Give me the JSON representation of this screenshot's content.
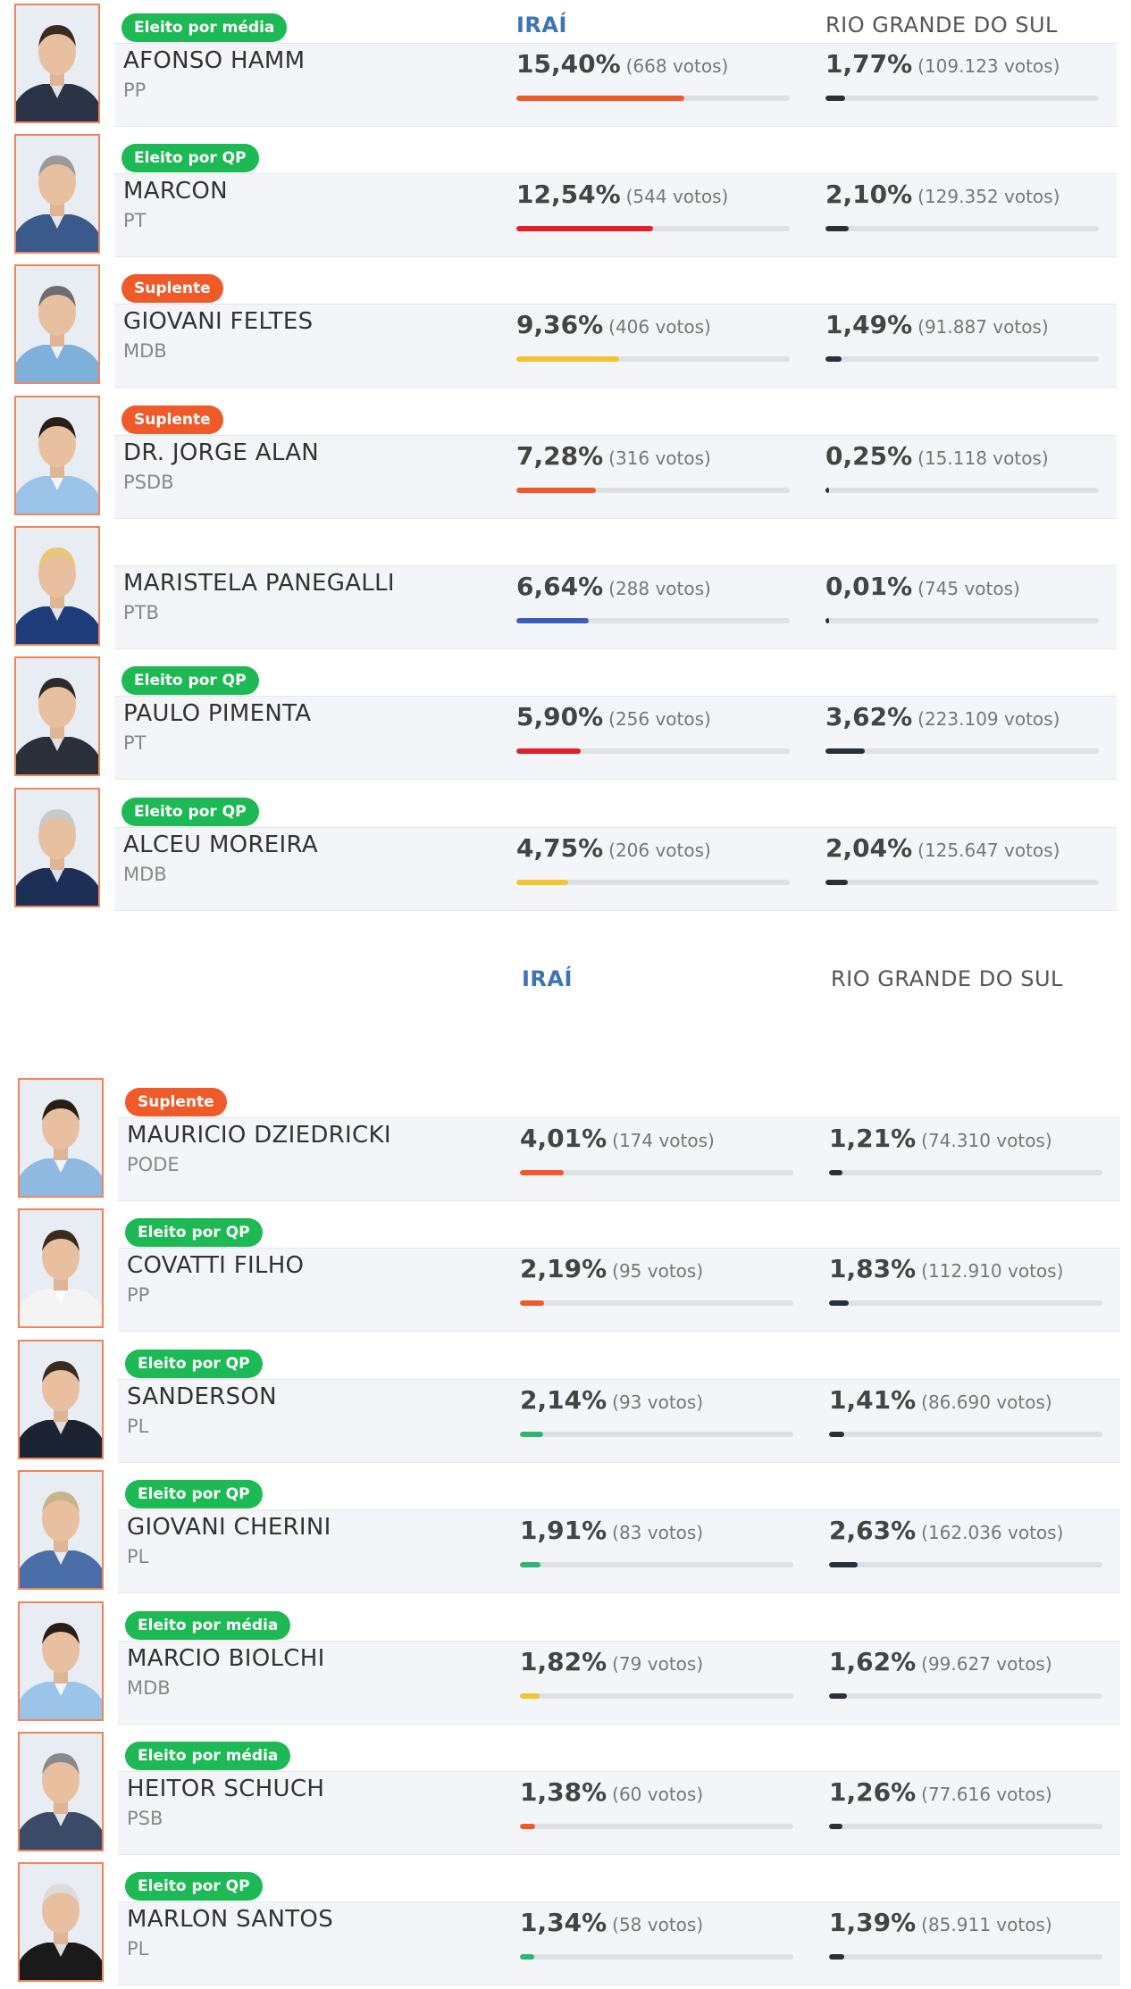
{
  "headers": {
    "irai": "IRAÍ",
    "rs": "RIO GRANDE DO SUL"
  },
  "candidates": [
    {
      "name": "AFONSO HAMM",
      "party": "PP",
      "badge": "Eleito por média",
      "badge_type": "green",
      "irai_pct": "15,40%",
      "irai_votes": "(668 votos)",
      "irai_share": 0.154,
      "rs_pct": "1,77%",
      "rs_votes": "(109.123 votos)",
      "rs_share": 0.0177,
      "color": "#f05a28"
    },
    {
      "name": "MARCON",
      "party": "PT",
      "badge": "Eleito por QP",
      "badge_type": "green",
      "irai_pct": "12,54%",
      "irai_votes": "(544 votos)",
      "irai_share": 0.1254,
      "rs_pct": "2,10%",
      "rs_votes": "(129.352 votos)",
      "rs_share": 0.021,
      "color": "#e0202a"
    },
    {
      "name": "GIOVANI FELTES",
      "party": "MDB",
      "badge": "Suplente",
      "badge_type": "orange",
      "irai_pct": "9,36%",
      "irai_votes": "(406 votos)",
      "irai_share": 0.0936,
      "rs_pct": "1,49%",
      "rs_votes": "(91.887 votos)",
      "rs_share": 0.0149,
      "color": "#f4c430"
    },
    {
      "name": "DR. JORGE ALAN",
      "party": "PSDB",
      "badge": "Suplente",
      "badge_type": "orange",
      "irai_pct": "7,28%",
      "irai_votes": "(316 votos)",
      "irai_share": 0.0728,
      "rs_pct": "0,25%",
      "rs_votes": "(15.118 votos)",
      "rs_share": 0.0025,
      "color": "#f05a28"
    },
    {
      "name": "MARISTELA PANEGALLI",
      "party": "PTB",
      "badge": "",
      "badge_type": "",
      "irai_pct": "6,64%",
      "irai_votes": "(288 votos)",
      "irai_share": 0.0664,
      "rs_pct": "0,01%",
      "rs_votes": "(745 votos)",
      "rs_share": 0.0001,
      "color": "#3d5fb8"
    },
    {
      "name": "PAULO PIMENTA",
      "party": "PT",
      "badge": "Eleito por QP",
      "badge_type": "green",
      "irai_pct": "5,90%",
      "irai_votes": "(256 votos)",
      "irai_share": 0.059,
      "rs_pct": "3,62%",
      "rs_votes": "(223.109 votos)",
      "rs_share": 0.0362,
      "color": "#e0202a"
    },
    {
      "name": "ALCEU MOREIRA",
      "party": "MDB",
      "badge": "Eleito por QP",
      "badge_type": "green",
      "irai_pct": "4,75%",
      "irai_votes": "(206 votos)",
      "irai_share": 0.0475,
      "rs_pct": "2,04%",
      "rs_votes": "(125.647 votos)",
      "rs_share": 0.0204,
      "color": "#f4c430"
    },
    {
      "name": "MAURICIO DZIEDRICKI",
      "party": "PODE",
      "badge": "Suplente",
      "badge_type": "orange",
      "irai_pct": "4,01%",
      "irai_votes": "(174 votos)",
      "irai_share": 0.0401,
      "rs_pct": "1,21%",
      "rs_votes": "(74.310 votos)",
      "rs_share": 0.0121,
      "color": "#f05a28"
    },
    {
      "name": "COVATTI FILHO",
      "party": "PP",
      "badge": "Eleito por QP",
      "badge_type": "green",
      "irai_pct": "2,19%",
      "irai_votes": "(95 votos)",
      "irai_share": 0.0219,
      "rs_pct": "1,83%",
      "rs_votes": "(112.910 votos)",
      "rs_share": 0.0183,
      "color": "#f05a28"
    },
    {
      "name": "SANDERSON",
      "party": "PL",
      "badge": "Eleito por QP",
      "badge_type": "green",
      "irai_pct": "2,14%",
      "irai_votes": "(93 votos)",
      "irai_share": 0.0214,
      "rs_pct": "1,41%",
      "rs_votes": "(86.690 votos)",
      "rs_share": 0.0141,
      "color": "#2bb673"
    },
    {
      "name": "GIOVANI CHERINI",
      "party": "PL",
      "badge": "Eleito por QP",
      "badge_type": "green",
      "irai_pct": "1,91%",
      "irai_votes": "(83 votos)",
      "irai_share": 0.0191,
      "rs_pct": "2,63%",
      "rs_votes": "(162.036 votos)",
      "rs_share": 0.0263,
      "color": "#2bb673"
    },
    {
      "name": "MARCIO BIOLCHI",
      "party": "MDB",
      "badge": "Eleito por média",
      "badge_type": "green",
      "irai_pct": "1,82%",
      "irai_votes": "(79 votos)",
      "irai_share": 0.0182,
      "rs_pct": "1,62%",
      "rs_votes": "(99.627 votos)",
      "rs_share": 0.0162,
      "color": "#f4c430"
    },
    {
      "name": "HEITOR SCHUCH",
      "party": "PSB",
      "badge": "Eleito por média",
      "badge_type": "green",
      "irai_pct": "1,38%",
      "irai_votes": "(60 votos)",
      "irai_share": 0.0138,
      "rs_pct": "1,26%",
      "rs_votes": "(77.616 votos)",
      "rs_share": 0.0126,
      "color": "#f05a28"
    },
    {
      "name": "MARLON SANTOS",
      "party": "PL",
      "badge": "Eleito por QP",
      "badge_type": "green",
      "irai_pct": "1,34%",
      "irai_votes": "(58 votos)",
      "irai_share": 0.0134,
      "rs_pct": "1,39%",
      "rs_votes": "(85.911 votos)",
      "rs_share": 0.0139,
      "color": "#2bb673"
    }
  ]
}
